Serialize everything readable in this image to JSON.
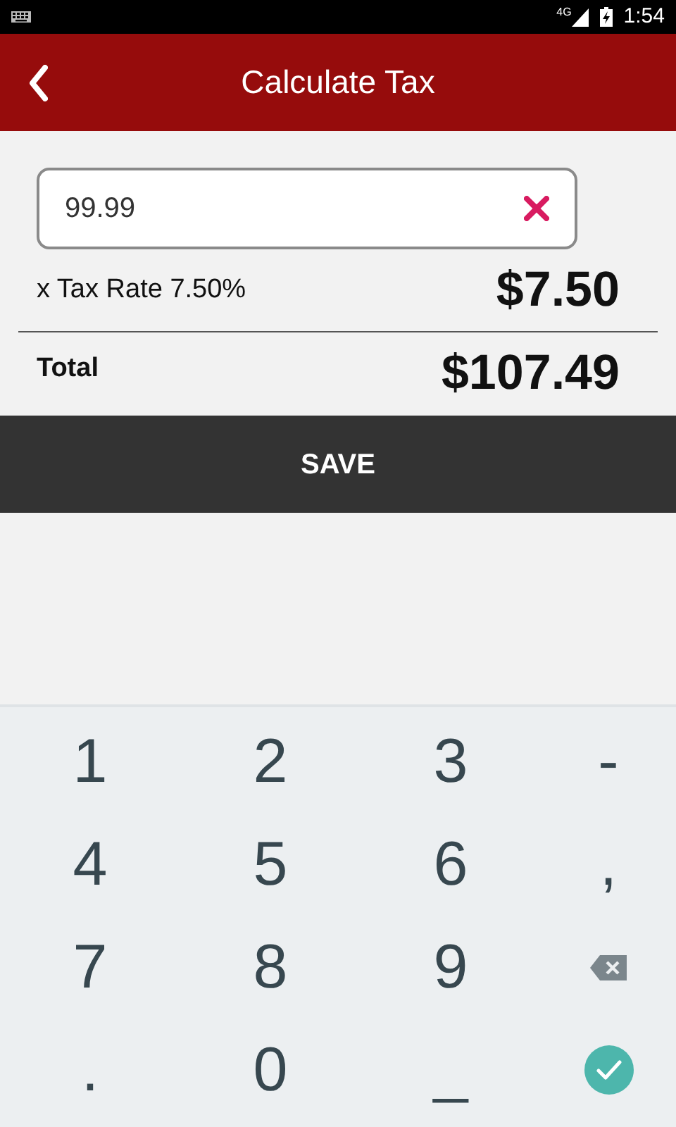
{
  "status_bar": {
    "network": "4G",
    "time": "1:54"
  },
  "app_bar": {
    "title": "Calculate Tax"
  },
  "amount_field": {
    "value": "99.99"
  },
  "tax_row": {
    "label": "x Tax Rate 7.50%",
    "value": "$7.50"
  },
  "total_row": {
    "label": "Total",
    "value": "$107.49"
  },
  "save_button": {
    "label": "SAVE"
  },
  "keypad": {
    "keys": [
      {
        "kind": "char",
        "label": "1"
      },
      {
        "kind": "char",
        "label": "2"
      },
      {
        "kind": "char",
        "label": "3"
      },
      {
        "kind": "char",
        "label": "-"
      },
      {
        "kind": "char",
        "label": "4"
      },
      {
        "kind": "char",
        "label": "5"
      },
      {
        "kind": "char",
        "label": "6"
      },
      {
        "kind": "char",
        "label": ","
      },
      {
        "kind": "char",
        "label": "7"
      },
      {
        "kind": "char",
        "label": "8"
      },
      {
        "kind": "char",
        "label": "9"
      },
      {
        "kind": "backspace"
      },
      {
        "kind": "char",
        "label": "."
      },
      {
        "kind": "char",
        "label": "0"
      },
      {
        "kind": "char",
        "label": "_"
      },
      {
        "kind": "done"
      }
    ]
  }
}
